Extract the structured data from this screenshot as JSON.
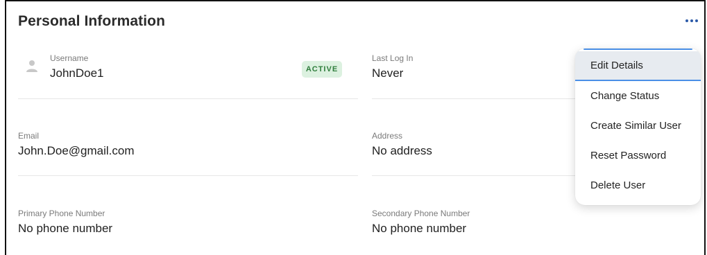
{
  "card": {
    "title": "Personal Information"
  },
  "fields": {
    "username": {
      "label": "Username",
      "value": "JohnDoe1"
    },
    "status_badge": "ACTIVE",
    "last_login": {
      "label": "Last Log In",
      "value": "Never"
    },
    "email": {
      "label": "Email",
      "value": "John.Doe@gmail.com"
    },
    "address": {
      "label": "Address",
      "value": "No address"
    },
    "primary_phone": {
      "label": "Primary Phone Number",
      "value": "No phone number"
    },
    "secondary_phone": {
      "label": "Secondary Phone Number",
      "value": "No phone number"
    }
  },
  "menu": {
    "items": [
      {
        "label": "Edit Details"
      },
      {
        "label": "Change Status"
      },
      {
        "label": "Create Similar User"
      },
      {
        "label": "Reset Password"
      },
      {
        "label": "Delete User"
      }
    ]
  },
  "icons": {
    "user": "user-icon",
    "more": "more-horizontal-icon"
  },
  "colors": {
    "badge_bg": "#dcf1e0",
    "badge_text": "#2f7d3c",
    "accent": "#4a8fe6",
    "more_dots": "#2b5aa8"
  }
}
